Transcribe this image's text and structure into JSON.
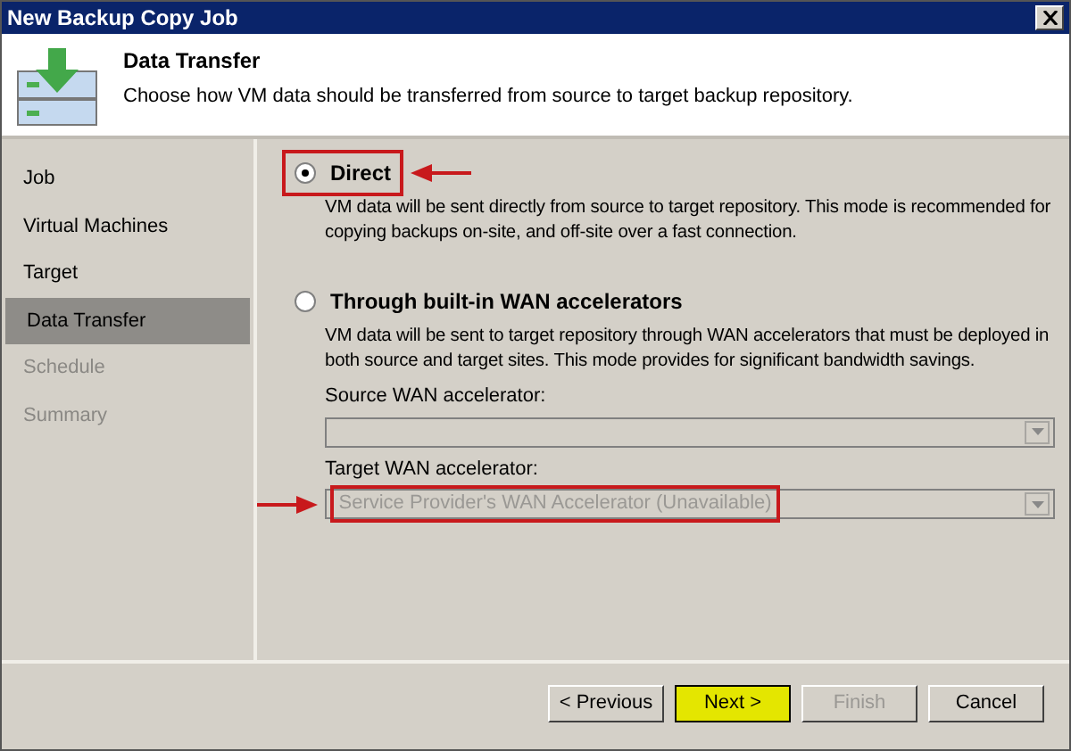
{
  "window": {
    "title": "New Backup Copy Job"
  },
  "header": {
    "title": "Data Transfer",
    "description": "Choose how VM data should be transferred from source to target backup repository."
  },
  "steps": [
    {
      "label": "Job",
      "selected": false,
      "disabled": false
    },
    {
      "label": "Virtual Machines",
      "selected": false,
      "disabled": false
    },
    {
      "label": "Target",
      "selected": false,
      "disabled": false
    },
    {
      "label": "Data Transfer",
      "selected": true,
      "disabled": false
    },
    {
      "label": "Schedule",
      "selected": false,
      "disabled": true
    },
    {
      "label": "Summary",
      "selected": false,
      "disabled": true
    }
  ],
  "options": [
    {
      "label": "Direct",
      "selected": true,
      "description": "VM data will be sent directly from source to target repository. This mode is recommended for copying backups on-site, and off-site over a fast connection."
    },
    {
      "label": "Through built-in WAN accelerators",
      "selected": false,
      "description": "VM data will be sent to target repository through WAN accelerators that must be deployed in both source and target sites. This mode provides for significant bandwidth savings."
    }
  ],
  "fields": [
    {
      "label": "Source WAN accelerator:",
      "disabled": true
    },
    {
      "label": "Target WAN accelerator:",
      "value": "Service Provider's WAN Accelerator (Unavailable)",
      "disabled": true
    }
  ],
  "buttons": [
    {
      "label": "< Previous",
      "disabled": false,
      "highlighted": false
    },
    {
      "label": "Next >",
      "disabled": false,
      "highlighted": true
    },
    {
      "label": "Finish",
      "disabled": true,
      "highlighted": false
    },
    {
      "label": "Cancel",
      "disabled": false,
      "highlighted": false
    }
  ]
}
